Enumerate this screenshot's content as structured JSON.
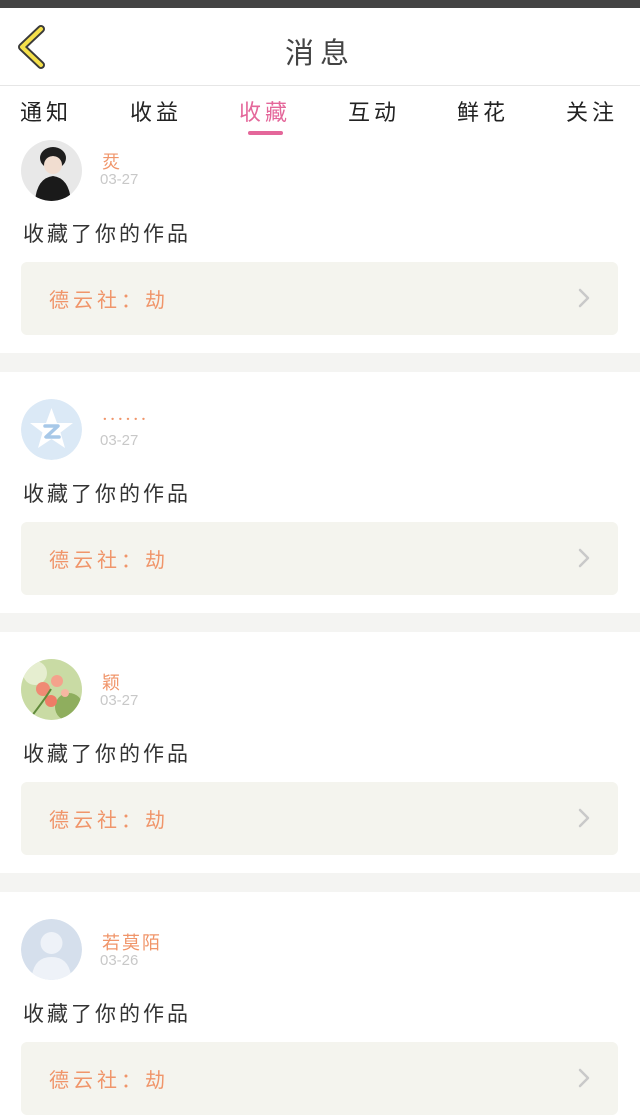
{
  "header": {
    "title": "消息",
    "back_icon": "chevron-left-icon"
  },
  "tabs": [
    {
      "label": "通知"
    },
    {
      "label": "收益"
    },
    {
      "label": "收藏",
      "active": true
    },
    {
      "label": "互动"
    },
    {
      "label": "鲜花"
    },
    {
      "label": "关注"
    }
  ],
  "colors": {
    "accent": "#e4679a",
    "username": "#f0956a",
    "back_icon": "#f5e04a"
  },
  "messages": [
    {
      "username": "烎",
      "date": "03-27",
      "action": "收藏了你的作品",
      "work_title": "德云社：劫",
      "avatar": "girl-in-black-avatar"
    },
    {
      "username": "······",
      "date": "03-27",
      "action": "收藏了你的作品",
      "work_title": "德云社：劫",
      "avatar": "qzone-star-avatar"
    },
    {
      "username": "颖",
      "date": "03-27",
      "action": "收藏了你的作品",
      "work_title": "德云社：劫",
      "avatar": "flowers-avatar"
    },
    {
      "username": "若莫陌",
      "date": "03-26",
      "action": "收藏了你的作品",
      "work_title": "德云社：劫",
      "avatar": "default-person-avatar"
    }
  ]
}
